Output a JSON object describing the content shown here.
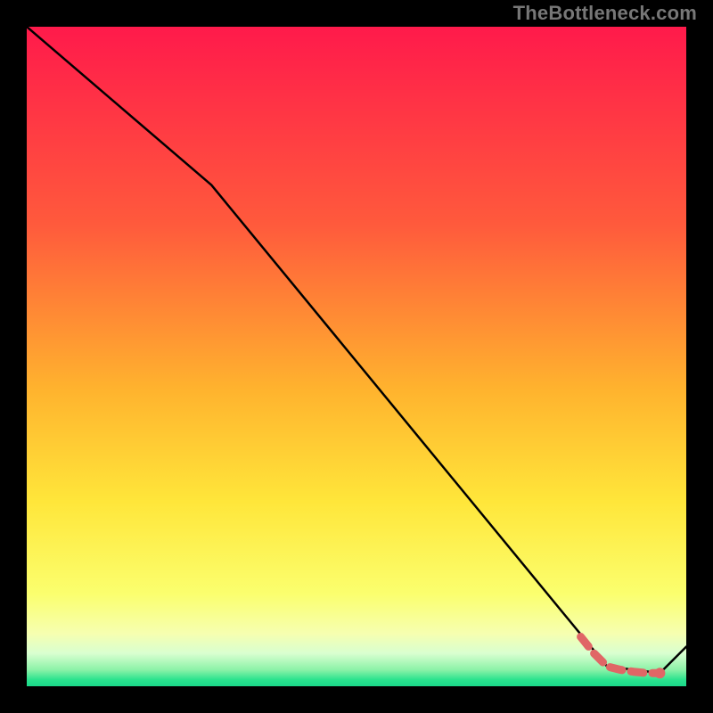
{
  "attribution": "TheBottleneck.com",
  "chart_data": {
    "type": "line",
    "title": "",
    "xlabel": "",
    "ylabel": "",
    "xlim": [
      0,
      100
    ],
    "ylim": [
      0,
      100
    ],
    "grid": false,
    "series": [
      {
        "name": "bottleneck-curve",
        "color": "#000000",
        "x": [
          0,
          28,
          88,
          96,
          100
        ],
        "y": [
          100,
          76,
          3,
          2,
          6
        ]
      }
    ],
    "markers": {
      "name": "highlight-segment",
      "color": "#E06666",
      "x": [
        84,
        86,
        88,
        90,
        92,
        94,
        96
      ],
      "y": [
        7.5,
        5.0,
        3.0,
        2.5,
        2.2,
        2.0,
        2.0
      ]
    },
    "gradient_stops": [
      {
        "offset": 0,
        "color": "#ff1a4b"
      },
      {
        "offset": 0.3,
        "color": "#ff5a3c"
      },
      {
        "offset": 0.55,
        "color": "#ffb32e"
      },
      {
        "offset": 0.72,
        "color": "#ffe63a"
      },
      {
        "offset": 0.86,
        "color": "#fbff6e"
      },
      {
        "offset": 0.92,
        "color": "#f6ffb0"
      },
      {
        "offset": 0.95,
        "color": "#d9ffd0"
      },
      {
        "offset": 0.975,
        "color": "#8cf2a8"
      },
      {
        "offset": 0.99,
        "color": "#2be38e"
      },
      {
        "offset": 1.0,
        "color": "#1ad98a"
      }
    ]
  }
}
